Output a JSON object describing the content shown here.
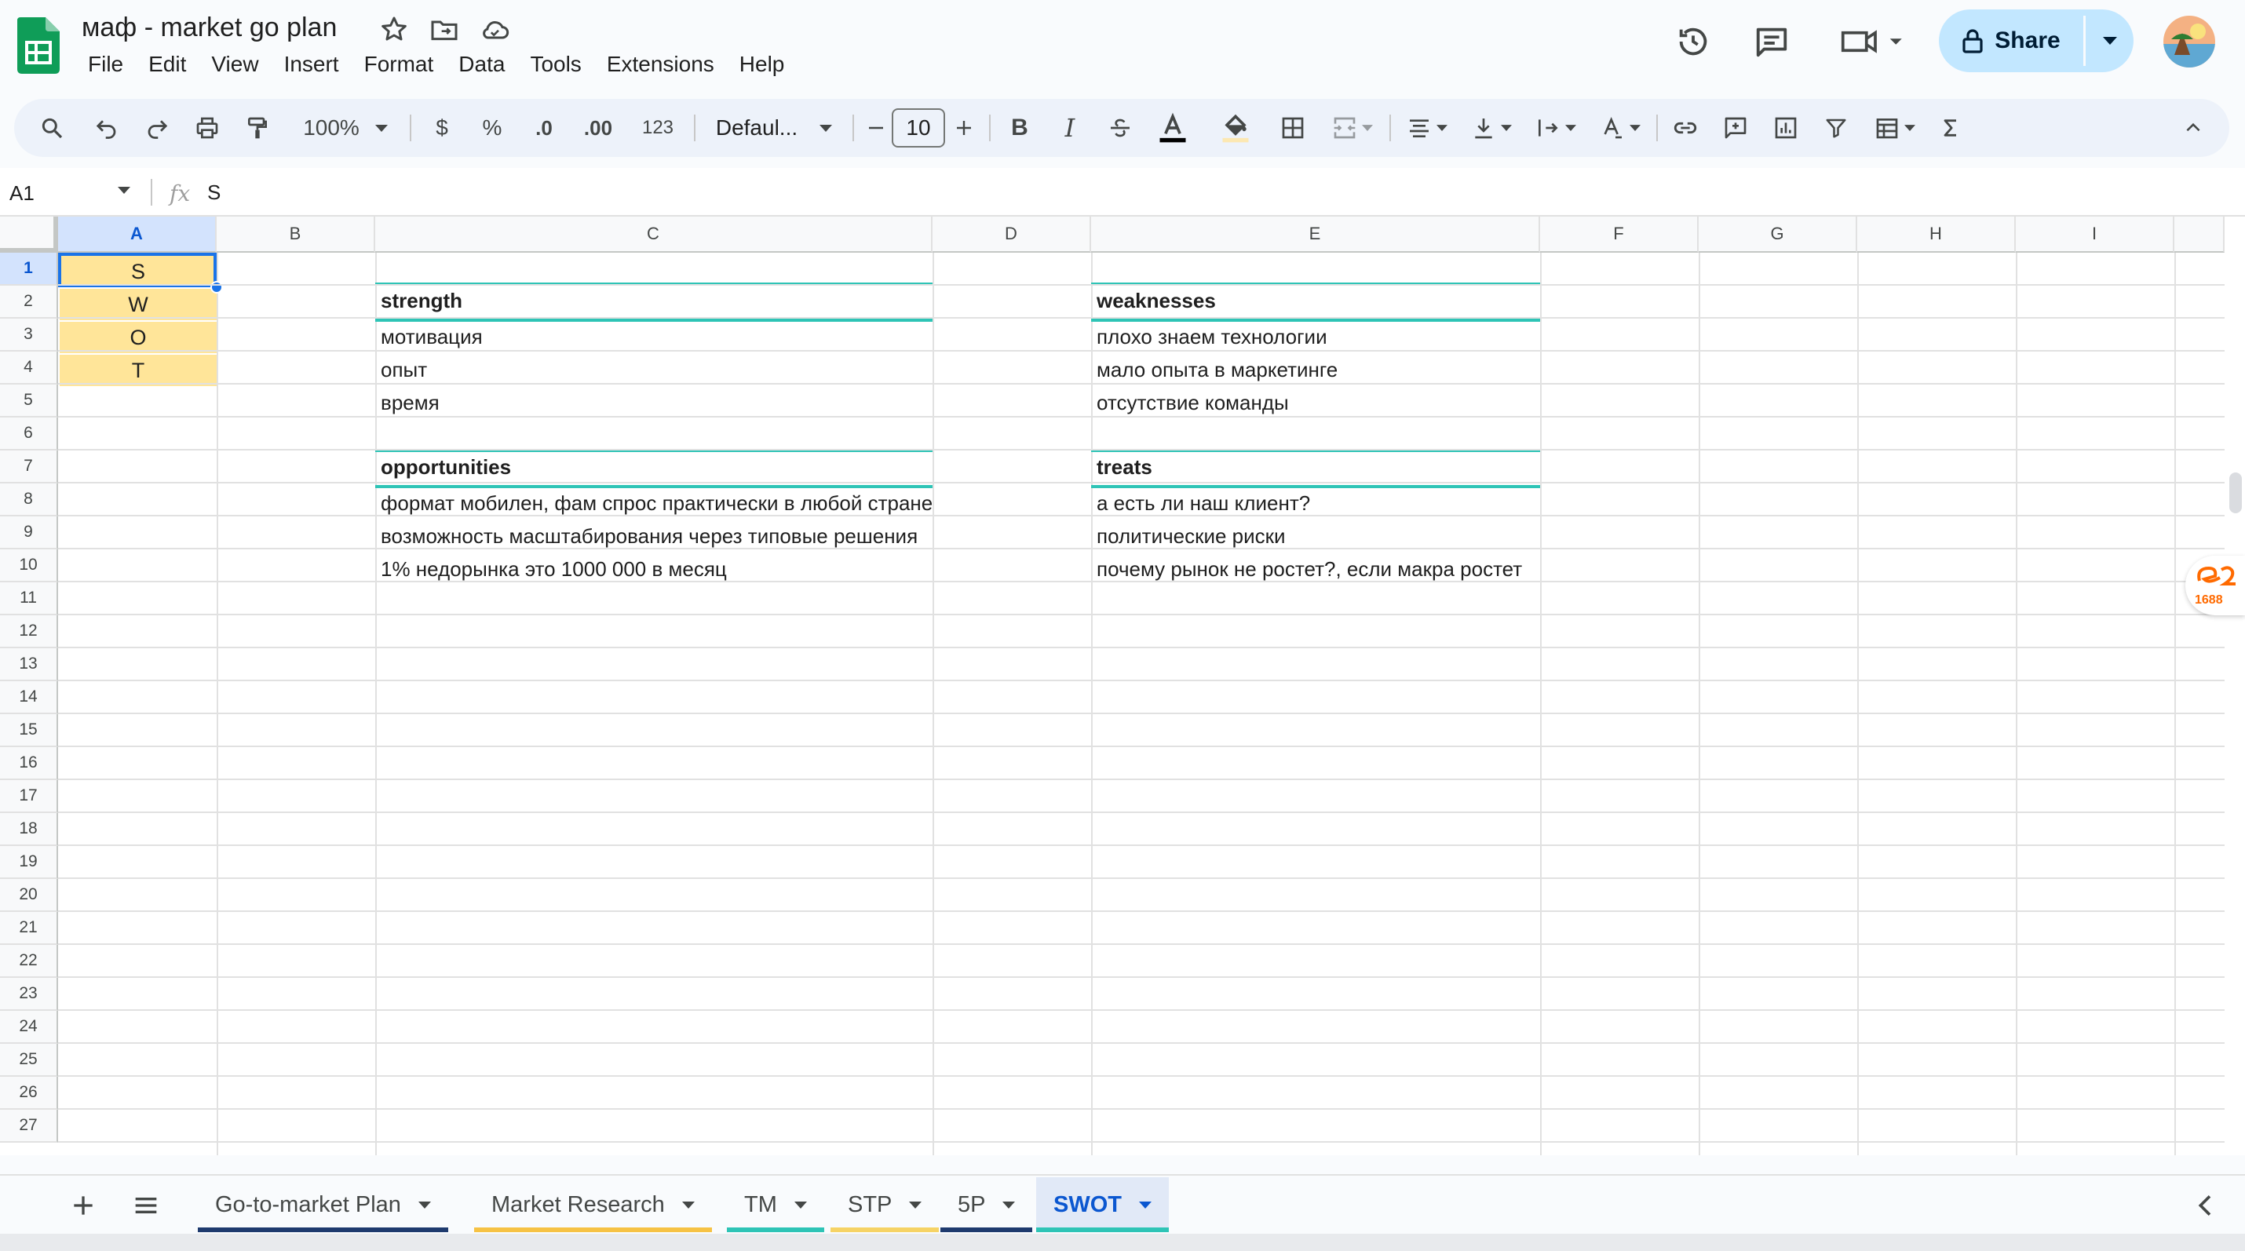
{
  "header": {
    "title": "маф - market go plan",
    "menu": [
      "File",
      "Edit",
      "View",
      "Insert",
      "Format",
      "Data",
      "Tools",
      "Extensions",
      "Help"
    ],
    "share_label": "Share"
  },
  "toolbar": {
    "zoom": "100%",
    "currency": "$",
    "percent": "%",
    "decrease_decimal": ".0",
    "increase_decimal": ".00",
    "number_format": "123",
    "font": "Defaul...",
    "font_size": "10",
    "bold": "B",
    "italic": "I"
  },
  "formula_bar": {
    "cell_ref": "A1",
    "fx": "fx",
    "content": "S"
  },
  "grid": {
    "columns": [
      "A",
      "B",
      "C",
      "D",
      "E",
      "F",
      "G",
      "H",
      "I"
    ],
    "rows": [
      "1",
      "2",
      "3",
      "4",
      "5",
      "6",
      "7",
      "8",
      "9",
      "10",
      "11",
      "12",
      "13",
      "14",
      "15",
      "16",
      "17",
      "18",
      "19",
      "20",
      "21",
      "22",
      "23",
      "24",
      "25",
      "26",
      "27"
    ],
    "swot_letters": [
      "S",
      "W",
      "O",
      "T"
    ],
    "strength": {
      "title": "strength",
      "items": [
        "мотивация",
        "опыт",
        "время"
      ]
    },
    "weaknesses": {
      "title": "weaknesses",
      "items": [
        "плохо знаем технологии",
        "мало опыта в маркетинге",
        "отсутствие команды"
      ]
    },
    "opportunities": {
      "title": "opportunities",
      "items": [
        "формат мобилен, фам спрос практически в любой стране",
        "возможность масштабирования через типовые решения",
        "1% недорынка это 1000 000 в месяц"
      ]
    },
    "treats": {
      "title": "treats",
      "items": [
        "а есть ли наш клиент?",
        "политические риски",
        "почему рынок не ростет?, если макра ростет"
      ]
    }
  },
  "extension_badge": "1688",
  "tabs": [
    {
      "label": "Go-to-market Plan",
      "color": "#1e3a6e",
      "active": false
    },
    {
      "label": "Market Research",
      "color": "#f6c244",
      "active": false
    },
    {
      "label": "TM",
      "color": "#2ec4b6",
      "active": false
    },
    {
      "label": "STP",
      "color": "#f6d365",
      "active": false
    },
    {
      "label": "5P",
      "color": "#1e3a6e",
      "active": false
    },
    {
      "label": "SWOT",
      "color": "#2ec4b6",
      "active": true
    }
  ],
  "colors": {
    "accent": "#0b57d0",
    "selection": "#1a73e8",
    "swot_fill": "#ffe599",
    "teal_border": "#2ec4b6",
    "share_bg": "#c2e7ff",
    "sheets_green": "#0f9d58"
  }
}
